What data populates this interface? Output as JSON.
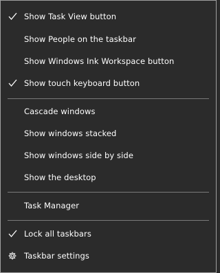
{
  "menu": {
    "items": [
      {
        "label": "Show Task View button",
        "checked": true
      },
      {
        "label": "Show People on the taskbar",
        "checked": false
      },
      {
        "label": "Show Windows Ink Workspace button",
        "checked": false
      },
      {
        "label": "Show touch keyboard button",
        "checked": true
      },
      {
        "label": "Cascade windows",
        "checked": false
      },
      {
        "label": "Show windows stacked",
        "checked": false
      },
      {
        "label": "Show windows side by side",
        "checked": false
      },
      {
        "label": "Show the desktop",
        "checked": false
      },
      {
        "label": "Task Manager",
        "checked": false
      },
      {
        "label": "Lock all taskbars",
        "checked": true
      },
      {
        "label": "Taskbar settings",
        "icon": "gear-icon"
      }
    ]
  },
  "colors": {
    "background": "#2b2b2b",
    "border": "#a0a0a0",
    "separator": "#7a7a7a",
    "text": "#ffffff"
  }
}
